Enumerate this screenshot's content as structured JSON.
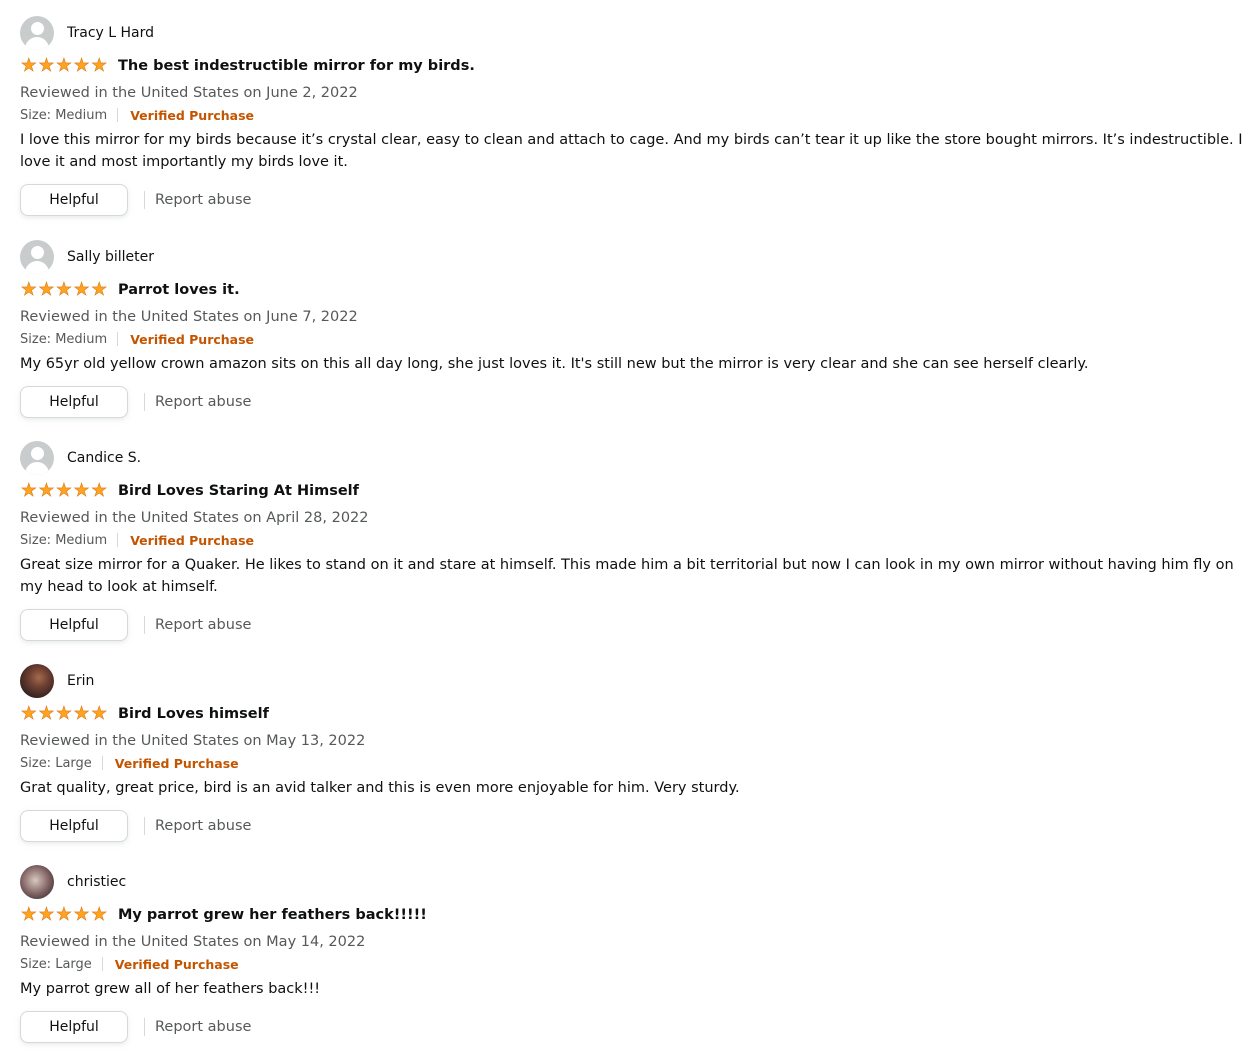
{
  "reviews": [
    {
      "reviewer": "Tracy L Hard",
      "avatar": "default-avatar-icon",
      "rating": 5,
      "title": "The best indestructible mirror for my birds.",
      "date": "Reviewed in the United States on June 2, 2022",
      "size": "Size: Medium",
      "verified": "Verified Purchase",
      "body": "I love this mirror for my birds because it’s crystal clear, easy to clean and attach to cage. And my birds can’t tear it up like the store bought mirrors. It’s indestructible. I love it and most importantly my birds love it.",
      "helpful": "Helpful",
      "report": "Report abuse"
    },
    {
      "reviewer": "Sally billeter",
      "avatar": "default-avatar-icon",
      "rating": 5,
      "title": "Parrot loves it.",
      "date": "Reviewed in the United States on June 7, 2022",
      "size": "Size: Medium",
      "verified": "Verified Purchase",
      "body": "My 65yr old yellow crown amazon sits on this all day long, she just loves it. It's still new but the mirror is very clear and she can see herself clearly.",
      "helpful": "Helpful",
      "report": "Report abuse"
    },
    {
      "reviewer": "Candice S.",
      "avatar": "default-avatar-icon",
      "rating": 5,
      "title": "Bird Loves Staring At Himself",
      "date": "Reviewed in the United States on April 28, 2022",
      "size": "Size: Medium",
      "verified": "Verified Purchase",
      "body": "Great size mirror for a Quaker. He likes to stand on it and stare at himself. This made him a bit territorial but now I can look in my own mirror without having him fly on my head to look at himself.",
      "helpful": "Helpful",
      "report": "Report abuse"
    },
    {
      "reviewer": "Erin",
      "avatar": "profile-photo",
      "rating": 5,
      "title": "Bird Loves himself",
      "date": "Reviewed in the United States on May 13, 2022",
      "size": "Size: Large",
      "verified": "Verified Purchase",
      "body": "Grat quality, great price, bird is an avid talker and this is even more enjoyable for him. Very sturdy.",
      "helpful": "Helpful",
      "report": "Report abuse"
    },
    {
      "reviewer": "christiec",
      "avatar": "profile-photo",
      "rating": 5,
      "title": "My parrot grew her feathers back!!!!!",
      "date": "Reviewed in the United States on May 14, 2022",
      "size": "Size: Large",
      "verified": "Verified Purchase",
      "body": "My parrot grew all of her feathers back!!!",
      "helpful": "Helpful",
      "report": "Report abuse"
    }
  ],
  "colors": {
    "star": "#ffa41c",
    "verified": "#c45500",
    "muted_text": "#565959",
    "body_text": "#0f1111"
  },
  "icons": {
    "star": "star-icon",
    "default_avatar": "default-avatar-icon"
  }
}
